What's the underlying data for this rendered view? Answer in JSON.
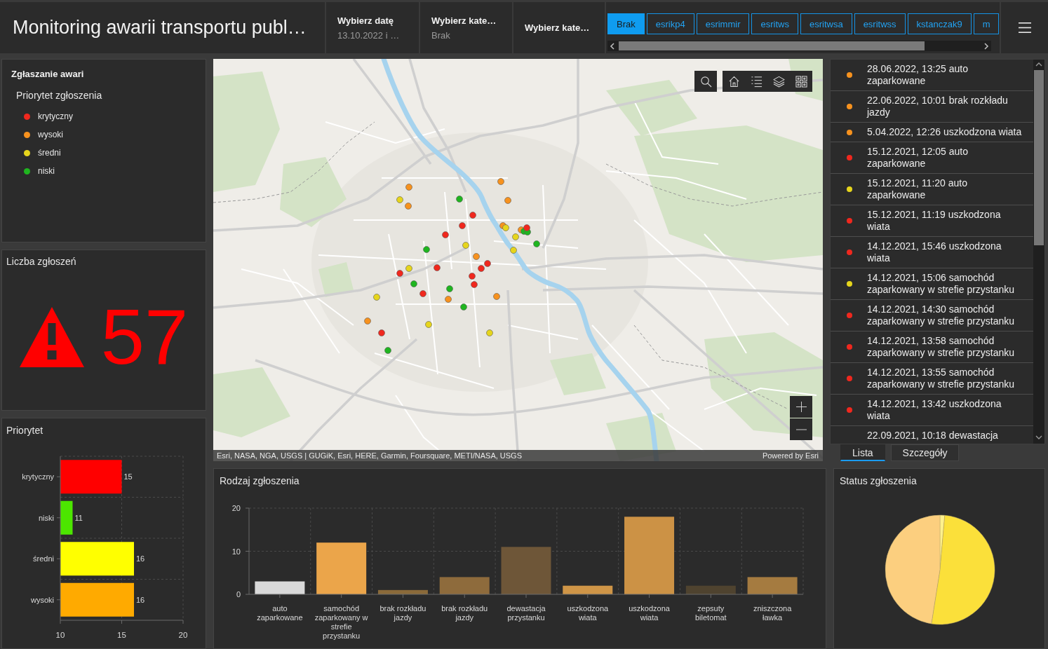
{
  "header": {
    "title": "Monitoring awarii transportu publ…",
    "filters": [
      {
        "label": "Wybierz datę",
        "value": "13.10.2022 i …"
      },
      {
        "label": "Wybierz kate…",
        "value": "Brak"
      },
      {
        "label": "Wybierz kate…"
      }
    ],
    "category_buttons": [
      {
        "label": "Brak",
        "selected": true
      },
      {
        "label": "esrikp4",
        "selected": false
      },
      {
        "label": "esrimmir",
        "selected": false
      },
      {
        "label": "esritws",
        "selected": false
      },
      {
        "label": "esritwsa",
        "selected": false
      },
      {
        "label": "esritwss",
        "selected": false
      },
      {
        "label": "kstanczak9",
        "selected": false
      },
      {
        "label": "m",
        "selected": false
      }
    ]
  },
  "legend": {
    "title": "Zgłaszanie awari",
    "subtitle": "Priorytet zgłoszenia",
    "items": [
      {
        "label": "krytyczny",
        "color": "#f0281e"
      },
      {
        "label": "wysoki",
        "color": "#f7921e"
      },
      {
        "label": "średni",
        "color": "#e6d51c"
      },
      {
        "label": "niski",
        "color": "#1fb51f"
      }
    ]
  },
  "count": {
    "title": "Liczba zgłoszeń",
    "value": "57"
  },
  "priority_chart": {
    "title": "Priorytet",
    "chart_data": {
      "type": "bar",
      "orientation": "horizontal",
      "stacked": true,
      "categories": [
        "krytyczny",
        "niski",
        "średni",
        "wysoki"
      ],
      "series": [
        {
          "color": "#ff0000",
          "values": [
            15,
            null,
            null,
            null
          ]
        },
        {
          "color": "#4ce600",
          "values": [
            null,
            11,
            null,
            null
          ]
        },
        {
          "color": "#ffff00",
          "values": [
            null,
            null,
            16,
            null
          ]
        },
        {
          "color": "#ffaa00",
          "values": [
            null,
            null,
            null,
            16
          ]
        }
      ],
      "xlim": [
        10,
        20
      ],
      "xticks": [
        10,
        15,
        20
      ],
      "data_labels": true
    }
  },
  "map": {
    "markers": [
      {
        "color": "#f7921e"
      },
      {
        "color": "#e6d51c"
      },
      {
        "color": "#f7921e"
      },
      {
        "color": "#1fb51f"
      },
      {
        "color": "#f7921e"
      },
      {
        "color": "#f7921e"
      },
      {
        "color": "#f0281e"
      },
      {
        "color": "#f0281e"
      },
      {
        "color": "#f0281e"
      },
      {
        "color": "#f7921e"
      },
      {
        "color": "#e6d51c"
      },
      {
        "color": "#f7921e"
      },
      {
        "color": "#1fb51f"
      },
      {
        "color": "#1fb51f"
      },
      {
        "color": "#f0281e"
      },
      {
        "color": "#e6d51c"
      },
      {
        "color": "#1fb51f"
      },
      {
        "color": "#1fb51f"
      },
      {
        "color": "#e6d51c"
      },
      {
        "color": "#e6d51c"
      },
      {
        "color": "#f7921e"
      },
      {
        "color": "#f0281e"
      },
      {
        "color": "#f0281e"
      },
      {
        "color": "#f0281e"
      },
      {
        "color": "#e6d51c"
      },
      {
        "color": "#f0281e"
      },
      {
        "color": "#f0281e"
      },
      {
        "color": "#f0281e"
      },
      {
        "color": "#1fb51f"
      },
      {
        "color": "#f0281e"
      },
      {
        "color": "#1fb51f"
      },
      {
        "color": "#f7921e"
      },
      {
        "color": "#1fb51f"
      },
      {
        "color": "#f7921e"
      },
      {
        "color": "#e6d51c"
      },
      {
        "color": "#f7921e"
      },
      {
        "color": "#e6d51c"
      },
      {
        "color": "#f0281e"
      },
      {
        "color": "#e6d51c"
      },
      {
        "color": "#1fb51f"
      }
    ],
    "attribution": "Esri, NASA, NGA, USGS | GUGiK, Esri, HERE, Garmin, Foursquare, METI/NASA, USGS",
    "powered_by": "Powered by Esri"
  },
  "reports": {
    "items": [
      {
        "text": "28.06.2022, 13:25 auto zaparkowane",
        "color": "#f7921e"
      },
      {
        "text": "22.06.2022, 10:01 brak rozkładu jazdy",
        "color": "#f7921e"
      },
      {
        "text": "5.04.2022, 12:26 uszkodzona wiata",
        "color": "#f7921e"
      },
      {
        "text": "15.12.2021, 12:05 auto zaparkowane",
        "color": "#f0281e"
      },
      {
        "text": "15.12.2021, 11:20 auto zaparkowane",
        "color": "#e6d51c"
      },
      {
        "text": "15.12.2021, 11:19 uszkodzona wiata",
        "color": "#f0281e"
      },
      {
        "text": "14.12.2021, 15:46 uszkodzona wiata",
        "color": "#f0281e"
      },
      {
        "text": "14.12.2021, 15:06 samochód zaparkowany w strefie przystanku",
        "color": "#e6d51c"
      },
      {
        "text": "14.12.2021, 14:30 samochód zaparkowany w strefie przystanku",
        "color": "#f0281e"
      },
      {
        "text": "14.12.2021, 13:58 samochód zaparkowany w strefie przystanku",
        "color": "#f0281e"
      },
      {
        "text": "14.12.2021, 13:55 samochód zaparkowany w strefie przystanku",
        "color": "#f0281e"
      },
      {
        "text": "14.12.2021, 13:42 uszkodzona wiata",
        "color": "#f0281e"
      },
      {
        "text": "22.09.2021, 10:18 dewastacja"
      }
    ],
    "tabs": [
      {
        "label": "Lista",
        "selected": true
      },
      {
        "label": "Szczegóły",
        "selected": false
      }
    ]
  },
  "type_chart": {
    "title": "Rodzaj zgłoszenia",
    "chart_data": {
      "type": "bar",
      "stacked": true,
      "categories": [
        "auto zaparkowane",
        "samochód zaparkowany w strefie przystanku",
        "brak rozkładu jazdy",
        "brak rozkładu jazdy",
        "dewastacja przystanku",
        "uszkodzona wiata",
        "uszkodzona wiata",
        "zepsuty biletomat",
        "zniszczona ławka"
      ],
      "series": [
        {
          "color": "#d9d9d9",
          "values": [
            3,
            null,
            null,
            null,
            null,
            null,
            null,
            null,
            null
          ]
        },
        {
          "color": "#eba54a",
          "values": [
            null,
            12,
            null,
            null,
            null,
            null,
            null,
            null,
            null
          ]
        },
        {
          "color": "#8a6a3a",
          "values": [
            null,
            null,
            1,
            null,
            null,
            null,
            null,
            null,
            null
          ]
        },
        {
          "color": "#8e6b3c",
          "values": [
            null,
            null,
            null,
            4,
            null,
            null,
            null,
            null,
            null
          ]
        },
        {
          "color": "#6e5638",
          "values": [
            null,
            null,
            null,
            null,
            11,
            null,
            null,
            null,
            null
          ]
        },
        {
          "color": "#cf9547",
          "values": [
            null,
            null,
            null,
            null,
            null,
            2,
            null,
            null,
            null
          ]
        },
        {
          "color": "#cc9245",
          "values": [
            null,
            null,
            null,
            null,
            null,
            null,
            18,
            null,
            null
          ]
        },
        {
          "color": "#4f432f",
          "values": [
            null,
            null,
            null,
            null,
            null,
            null,
            null,
            2,
            null
          ]
        },
        {
          "color": "#a57b40",
          "values": [
            null,
            null,
            null,
            null,
            null,
            null,
            null,
            null,
            4
          ]
        }
      ],
      "ylim": [
        0,
        20
      ],
      "yticks": [
        0,
        10,
        20
      ]
    }
  },
  "status_chart": {
    "title": "Status zgłoszenia"
  }
}
